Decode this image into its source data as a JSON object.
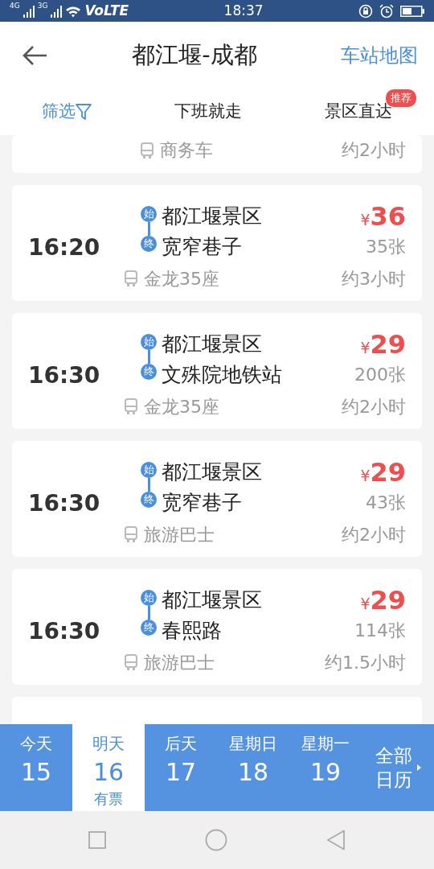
{
  "status_bar": {
    "signal_1": "4G",
    "signal_2": "3G",
    "volte": "VoLTE",
    "time": "18:37"
  },
  "header": {
    "title": "都江堰-成都",
    "action": "车站地图"
  },
  "filters": [
    {
      "label": "筛选",
      "kind": "filter"
    },
    {
      "label": "下班就走",
      "kind": "option"
    },
    {
      "label": "景区直达",
      "kind": "option",
      "badge": "推荐"
    }
  ],
  "trips": [
    {
      "bus": "商务车",
      "duration": "约2小时"
    },
    {
      "time": "16:20",
      "origin_mark": "始",
      "origin": "都江堰景区",
      "destination_mark": "终",
      "destination": "宽窄巷子",
      "currency": "¥",
      "price": "36",
      "tickets": "35张",
      "bus": "金龙35座",
      "duration": "约3小时"
    },
    {
      "time": "16:30",
      "origin_mark": "始",
      "origin": "都江堰景区",
      "destination_mark": "终",
      "destination": "文殊院地铁站",
      "currency": "¥",
      "price": "29",
      "tickets": "200张",
      "bus": "金龙35座",
      "duration": "约2小时"
    },
    {
      "time": "16:30",
      "origin_mark": "始",
      "origin": "都江堰景区",
      "destination_mark": "终",
      "destination": "宽窄巷子",
      "currency": "¥",
      "price": "29",
      "tickets": "43张",
      "bus": "旅游巴士",
      "duration": "约2小时"
    },
    {
      "time": "16:30",
      "origin_mark": "始",
      "origin": "都江堰景区",
      "destination_mark": "终",
      "destination": "春熙路",
      "currency": "¥",
      "price": "29",
      "tickets": "114张",
      "bus": "旅游巴士",
      "duration": "约1.5小时"
    }
  ],
  "dates": [
    {
      "label": "今天",
      "day": "15",
      "selected": false
    },
    {
      "label": "明天",
      "day": "16",
      "note": "有票",
      "selected": true
    },
    {
      "label": "后天",
      "day": "17",
      "selected": false
    },
    {
      "label": "星期日",
      "day": "18",
      "selected": false
    },
    {
      "label": "星期一",
      "day": "19",
      "selected": false
    }
  ],
  "calendar_button": "全部日历"
}
